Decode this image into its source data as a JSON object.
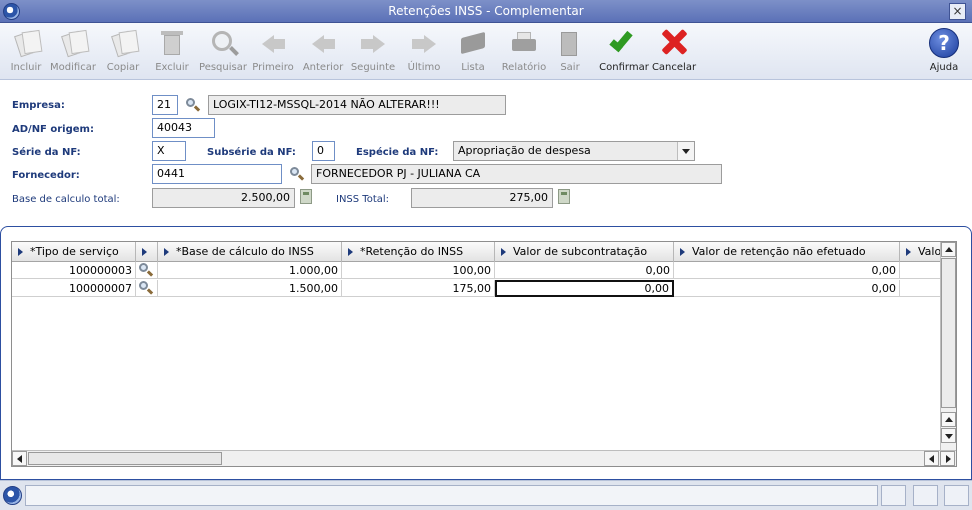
{
  "window": {
    "title": "Retenções INSS - Complementar",
    "close_glyph": "×"
  },
  "toolbar": {
    "buttons": [
      {
        "label": "Incluir",
        "icon": "add-document-icon",
        "enabled": false
      },
      {
        "label": "Modificar",
        "icon": "edit-document-icon",
        "enabled": false
      },
      {
        "label": "Copiar",
        "icon": "copy-document-icon",
        "enabled": false
      },
      {
        "label": "Excluir",
        "icon": "trash-icon",
        "enabled": false
      },
      {
        "label": "Pesquisar",
        "icon": "search-icon",
        "enabled": false
      },
      {
        "label": "Primeiro",
        "icon": "first-arrow-icon",
        "enabled": false
      },
      {
        "label": "Anterior",
        "icon": "previous-arrow-icon",
        "enabled": false
      },
      {
        "label": "Seguinte",
        "icon": "next-arrow-icon",
        "enabled": false
      },
      {
        "label": "Último",
        "icon": "last-arrow-icon",
        "enabled": false
      },
      {
        "label": "Lista",
        "icon": "list-book-icon",
        "enabled": false
      },
      {
        "label": "Relatório",
        "icon": "printer-icon",
        "enabled": false
      },
      {
        "label": "Sair",
        "icon": "exit-door-icon",
        "enabled": false
      },
      {
        "label": "Confirmar",
        "icon": "check-icon",
        "enabled": true
      },
      {
        "label": "Cancelar",
        "icon": "cancel-x-icon",
        "enabled": true
      }
    ],
    "help": {
      "label": "Ajuda",
      "glyph": "?"
    }
  },
  "form": {
    "empresa": {
      "label": "Empresa:",
      "code": "21",
      "name": "LOGIX-TI12-MSSQL-2014 NÃO ALTERAR!!!"
    },
    "ad_nf_origem": {
      "label": "AD/NF origem:",
      "value": "40043"
    },
    "serie_nf": {
      "label": "Série da NF:",
      "value": "X"
    },
    "subserie_nf": {
      "label": "Subsérie da NF:",
      "value": "0"
    },
    "especie_nf": {
      "label": "Espécie da NF:",
      "value": "Apropriação de despesa"
    },
    "fornecedor": {
      "label": "Fornecedor:",
      "code": "0441",
      "name": "FORNECEDOR PJ - JULIANA CA"
    },
    "base_calculo_total": {
      "label": "Base de calculo total:",
      "value": "2.500,00"
    },
    "inss_total": {
      "label": "INSS Total:",
      "value": "275,00"
    }
  },
  "grid": {
    "columns": [
      "*Tipo de serviço",
      "",
      "*Base de cálculo do INSS",
      "*Retenção do INSS",
      "Valor de subcontratação",
      "Valor de retenção não efetuado",
      "Valo"
    ],
    "rows": [
      {
        "tipo": "100000003",
        "base": "1.000,00",
        "retencao": "100,00",
        "subcontratacao": "0,00",
        "nao_efetuado": "0,00"
      },
      {
        "tipo": "100000007",
        "base": "1.500,00",
        "retencao": "175,00",
        "subcontratacao": "0,00",
        "nao_efetuado": "0,00"
      }
    ]
  }
}
